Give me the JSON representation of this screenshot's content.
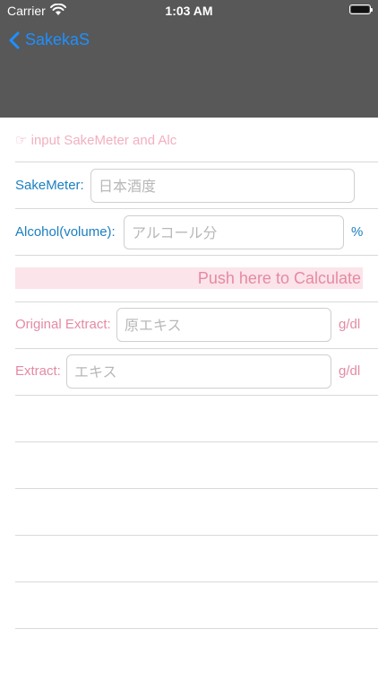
{
  "status_bar": {
    "carrier": "Carrier",
    "time": "1:03 AM"
  },
  "nav": {
    "back_label": "SakekaS"
  },
  "form": {
    "hint": "☞ input SakeMeter and Alc",
    "sakemeter": {
      "label": "SakeMeter:",
      "placeholder": "日本酒度",
      "value": ""
    },
    "alcohol": {
      "label": "Alcohol(volume):",
      "placeholder": "アルコール分",
      "value": "",
      "unit": "%"
    },
    "calculate_label": "Push here to Calculate",
    "original_extract": {
      "label": "Original Extract:",
      "placeholder": "原エキス",
      "value": "",
      "unit": "g/dl"
    },
    "extract": {
      "label": "Extract:",
      "placeholder": "エキス",
      "value": "",
      "unit": "g/dl"
    }
  },
  "colors": {
    "nav_background": "#585858",
    "accent_blue": "#1b7fc0",
    "accent_pink": "#e58aa3",
    "calc_background": "#fbe4ea",
    "hint_pink": "#f2b0c0"
  }
}
